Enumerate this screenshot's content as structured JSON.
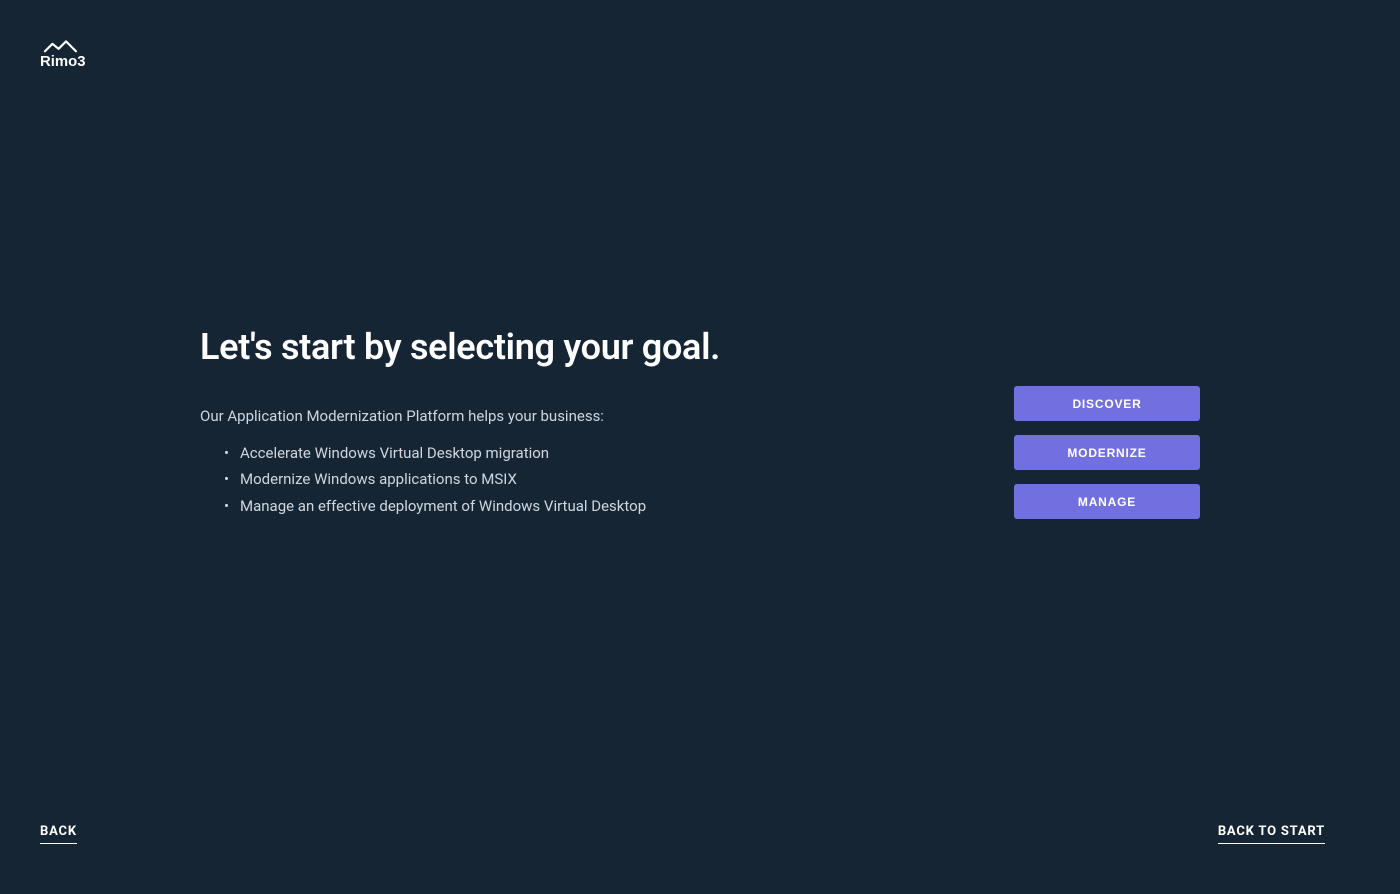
{
  "logo": {
    "brand_name": "Rimo3"
  },
  "main": {
    "heading": "Let's start by selecting your goal.",
    "intro": "Our Application Modernization Platform helps your business:",
    "features": [
      "Accelerate Windows Virtual Desktop migration",
      "Modernize Windows applications to MSIX",
      "Manage an effective deployment of Windows Virtual Desktop"
    ]
  },
  "actions": {
    "discover_label": "DISCOVER",
    "modernize_label": "MODERNIZE",
    "manage_label": "MANAGE"
  },
  "footer": {
    "back_label": "BACK",
    "back_to_start_label": "BACK TO START"
  },
  "colors": {
    "background": "#162534",
    "accent": "#7270e0",
    "text_primary": "#ffffff",
    "text_secondary": "#d0d6dd"
  }
}
